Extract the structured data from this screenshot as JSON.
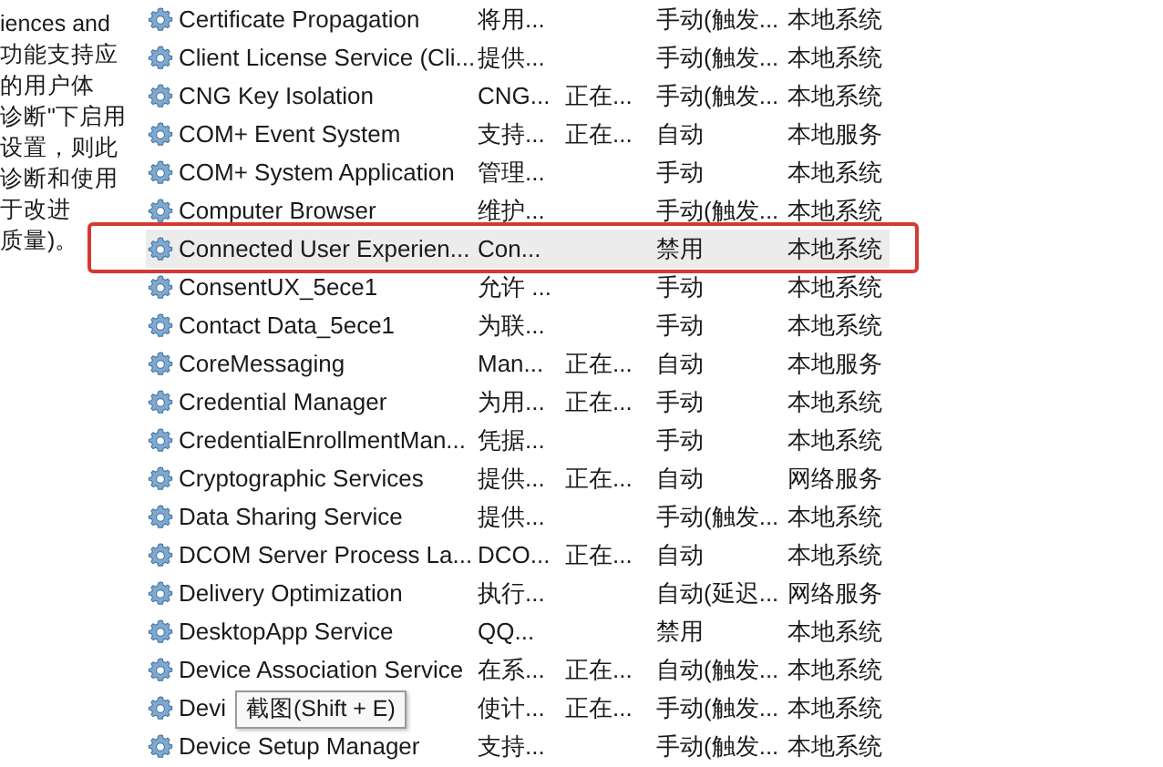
{
  "description_panel": {
    "lines": [
      "iences and",
      "功能支持应",
      "的用户体",
      "诊断\"下启用",
      "设置，则此",
      "诊断和使用",
      "于改进",
      "质量)。"
    ]
  },
  "services": [
    {
      "name": "Certificate Propagation",
      "description": "将用...",
      "startup": "手动(触发...",
      "logon": "本地系统",
      "selected": false
    },
    {
      "name": "Client License Service (Cli...",
      "description": "提供...",
      "startup": "手动(触发...",
      "logon": "本地系统",
      "selected": false
    },
    {
      "name": "CNG Key Isolation",
      "description": "CNG...",
      "status": "正在...",
      "startup": "手动(触发...",
      "logon": "本地系统",
      "selected": false
    },
    {
      "name": "COM+ Event System",
      "description": "支持...",
      "status": "正在...",
      "startup": "自动",
      "logon": "本地服务",
      "selected": false
    },
    {
      "name": "COM+ System Application",
      "description": "管理...",
      "startup": "手动",
      "logon": "本地系统",
      "selected": false
    },
    {
      "name": "Computer Browser",
      "description": "维护...",
      "startup": "手动(触发...",
      "logon": "本地系统",
      "selected": false
    },
    {
      "name": "Connected User Experien...",
      "description": "Con...",
      "startup": "禁用",
      "logon": "本地系统",
      "selected": true
    },
    {
      "name": "ConsentUX_5ece1",
      "description": "允许 ...",
      "startup": "手动",
      "logon": "本地系统",
      "selected": false
    },
    {
      "name": "Contact Data_5ece1",
      "description": "为联...",
      "startup": "手动",
      "logon": "本地系统",
      "selected": false
    },
    {
      "name": "CoreMessaging",
      "description": "Man...",
      "status": "正在...",
      "startup": "自动",
      "logon": "本地服务",
      "selected": false
    },
    {
      "name": "Credential Manager",
      "description": "为用...",
      "status": "正在...",
      "startup": "手动",
      "logon": "本地系统",
      "selected": false
    },
    {
      "name": "CredentialEnrollmentMan...",
      "description": "凭据...",
      "startup": "手动",
      "logon": "本地系统",
      "selected": false
    },
    {
      "name": "Cryptographic Services",
      "description": "提供...",
      "status": "正在...",
      "startup": "自动",
      "logon": "网络服务",
      "selected": false
    },
    {
      "name": "Data Sharing Service",
      "description": "提供...",
      "startup": "手动(触发...",
      "logon": "本地系统",
      "selected": false
    },
    {
      "name": "DCOM Server Process La...",
      "description": "DCO...",
      "status": "正在...",
      "startup": "自动",
      "logon": "本地系统",
      "selected": false
    },
    {
      "name": "Delivery Optimization",
      "description": "执行...",
      "startup": "自动(延迟...",
      "logon": "网络服务",
      "selected": false
    },
    {
      "name": "DesktopApp Service",
      "description": "QQ...",
      "startup": "禁用",
      "logon": "本地系统",
      "selected": false
    },
    {
      "name": "Device Association Service",
      "description": "在系...",
      "status": "正在...",
      "startup": "自动(触发...",
      "logon": "本地系统",
      "selected": false
    },
    {
      "name": "Devi",
      "description": "使计...",
      "status": "正在...",
      "startup": "手动(触发...",
      "logon": "本地系统",
      "selected": false
    },
    {
      "name": "Device Setup Manager",
      "description": "支持...",
      "startup": "手动(触发...",
      "logon": "本地系统",
      "selected": false
    }
  ],
  "tooltip": {
    "text": "截图(Shift + E)"
  }
}
